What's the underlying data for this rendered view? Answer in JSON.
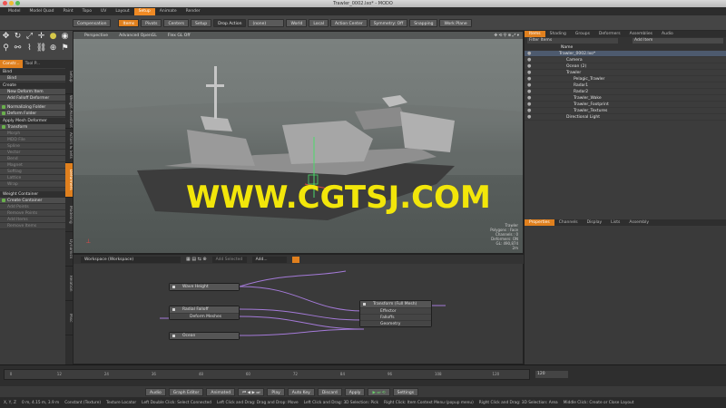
{
  "window": {
    "title": "Trawler_0002.lxo* - MODO"
  },
  "layout_tabs": [
    "Model",
    "Model Quad",
    "Paint",
    "Topo",
    "UV",
    "Layout",
    "Setup",
    "Animate",
    "Render"
  ],
  "active_layout_tab": "Setup",
  "toolbar": {
    "items": [
      "Compensation",
      "Items",
      "Pivots",
      "Centers",
      "Setup",
      "Drop Action",
      "(none)",
      "World",
      "Local",
      "Action Center",
      "Symmetry: Off",
      "Snapping",
      "Work Plane"
    ]
  },
  "left_panel": {
    "tabs": [
      "Constr...",
      "Tool P..."
    ],
    "bind_header": "Bind",
    "bind_button": "Bind",
    "create_header": "Create",
    "new_deform_item": "New Deform Item",
    "add_falloff": "Add Falloff Deformer",
    "normalizing_folder": "Normalizing Folder",
    "deform_folder": "Deform Folder",
    "apply_mesh": "Apply Mesh Deformer",
    "transform": "Transform",
    "morph": "Morph",
    "mdd_file": "MDD File",
    "spline": "Spline",
    "vector": "Vector",
    "bend": "Bend",
    "magnet": "Magnet",
    "softlag": "Softlag",
    "lattice": "Lattice",
    "wrap": "Wrap",
    "weight_header": "Weight Container",
    "create_container": "Create Container",
    "add_points": "Add Points",
    "remove_points": "Remove Points",
    "add_items": "Add Items",
    "remove_items": "Remove Items"
  },
  "vertical_tabs": [
    "Setup",
    "Weight Assistant",
    "Actors & Sets",
    "Deformers",
    "Modeling",
    "Dynamics",
    "Relation",
    "Misc"
  ],
  "viewport": {
    "header": [
      "Perspective",
      "Advanced OpenGL",
      "Flex GL Off"
    ],
    "info": [
      "Trawler",
      "Polygons : Face",
      "Channels : 0",
      "Deformers: ON",
      "GL: 490,874",
      "2m"
    ]
  },
  "watermark": "WWW.CGTSJ.COM",
  "node_editor": {
    "workspace": "Workspace (Workspace)",
    "add_selected": "Add Selected",
    "add": "Add...",
    "nodes": {
      "wave_height": "Wave Height",
      "radial_falloff": "Radial Falloff",
      "deform_meshes": "Deform Meshes",
      "ocean": "Ocean",
      "transform_full": "Transform (Full Mesh)",
      "effector": "Effector",
      "falloffs": "Falloffs",
      "geometry": "Geometry"
    }
  },
  "right_panel": {
    "tabs": [
      "Items",
      "Shading",
      "Groups",
      "Deformers",
      "Assemblies",
      "Audio"
    ],
    "filter": "Filter Items",
    "add_item": "Add Item",
    "column_header": "Name",
    "tree": [
      {
        "label": "Trawler_0002.lxo*",
        "depth": 0
      },
      {
        "label": "Camera",
        "depth": 1
      },
      {
        "label": "Ocean (2)",
        "depth": 1
      },
      {
        "label": "Trawler",
        "depth": 1
      },
      {
        "label": "Pelagic_Trawler",
        "depth": 2
      },
      {
        "label": "Radar1",
        "depth": 2
      },
      {
        "label": "Radar2",
        "depth": 2
      },
      {
        "label": "Trawler_Wake",
        "depth": 2
      },
      {
        "label": "Trawler_Footprint",
        "depth": 2
      },
      {
        "label": "Trawler_Textures",
        "depth": 2
      },
      {
        "label": "Directional Light",
        "depth": 1
      }
    ],
    "props_tabs": [
      "Properties",
      "Channels",
      "Display",
      "Lists",
      "Assembly"
    ]
  },
  "timeline": {
    "ticks": [
      "0",
      "12",
      "24",
      "36",
      "48",
      "60",
      "72",
      "84",
      "96",
      "108",
      "120"
    ],
    "frame": "120"
  },
  "bottom_bar": [
    "Audio",
    "Graph Editor",
    "Animated",
    "Play",
    "Auto Key",
    "Discard",
    "Apply",
    "Settings"
  ],
  "status_bar": [
    "X, Y, Z",
    "0 m, 4.15 m, 3.9 m",
    "Constant (Texture)",
    "Texture Locator",
    "Left Double Click: Select Connected",
    "Left Click and Drag: Drag and Drop: Move",
    "Left Click and Drag: 3D Selection: Pick",
    "Right Click: Item Context Menu (popup menu)",
    "Right Click and Drag: 3D Selection: Area",
    "Middle Click: Create or Close Layout"
  ]
}
